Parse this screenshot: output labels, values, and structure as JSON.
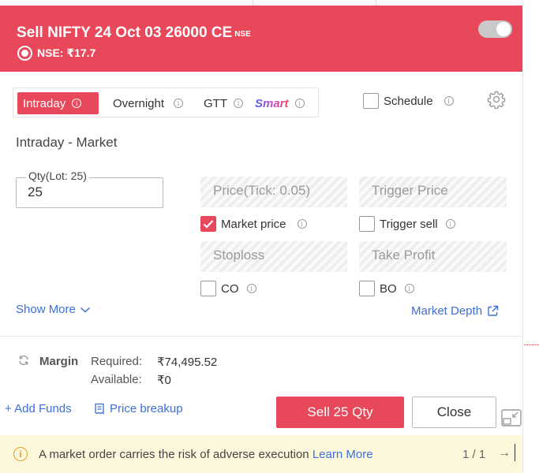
{
  "header": {
    "title": "Sell NIFTY 24 Oct 03 26000 CE",
    "exchange": "NSE",
    "price_text": "NSE: ₹17.7",
    "toggle_on": true
  },
  "tabs": [
    {
      "label": "Intraday",
      "active": true
    },
    {
      "label": "Overnight",
      "active": false
    },
    {
      "label": "GTT",
      "active": false
    },
    {
      "label": "Smart",
      "active": false
    }
  ],
  "schedule": {
    "label": "Schedule",
    "checked": false
  },
  "section_title": "Intraday - Market",
  "qty": {
    "label": "Qty(Lot: 25)",
    "value": "25"
  },
  "fields": {
    "price": "Price(Tick: 0.05)",
    "trigger_price": "Trigger Price",
    "stoploss": "Stoploss",
    "take_profit": "Take Profit"
  },
  "checks": {
    "market_price": {
      "label": "Market price",
      "checked": true
    },
    "trigger_sell": {
      "label": "Trigger sell",
      "checked": false
    },
    "co": {
      "label": "CO",
      "checked": false
    },
    "bo": {
      "label": "BO",
      "checked": false
    }
  },
  "links": {
    "show_more": "Show More",
    "market_depth": "Market Depth",
    "add_funds": "+ Add Funds",
    "price_breakup": "Price breakup"
  },
  "margin": {
    "label": "Margin",
    "required_label": "Required:",
    "required_value": "₹74,495.52",
    "available_label": "Available:",
    "available_value": "₹0"
  },
  "buttons": {
    "sell": "Sell 25 Qty",
    "close": "Close"
  },
  "warning": {
    "text": "A market order carries the risk of adverse execution",
    "link": "Learn More",
    "pager": "1 / 1",
    "next": "→"
  },
  "colors": {
    "accent": "#e8495a",
    "link": "#3d6fd6",
    "warning_bg": "#fdf8dc"
  }
}
